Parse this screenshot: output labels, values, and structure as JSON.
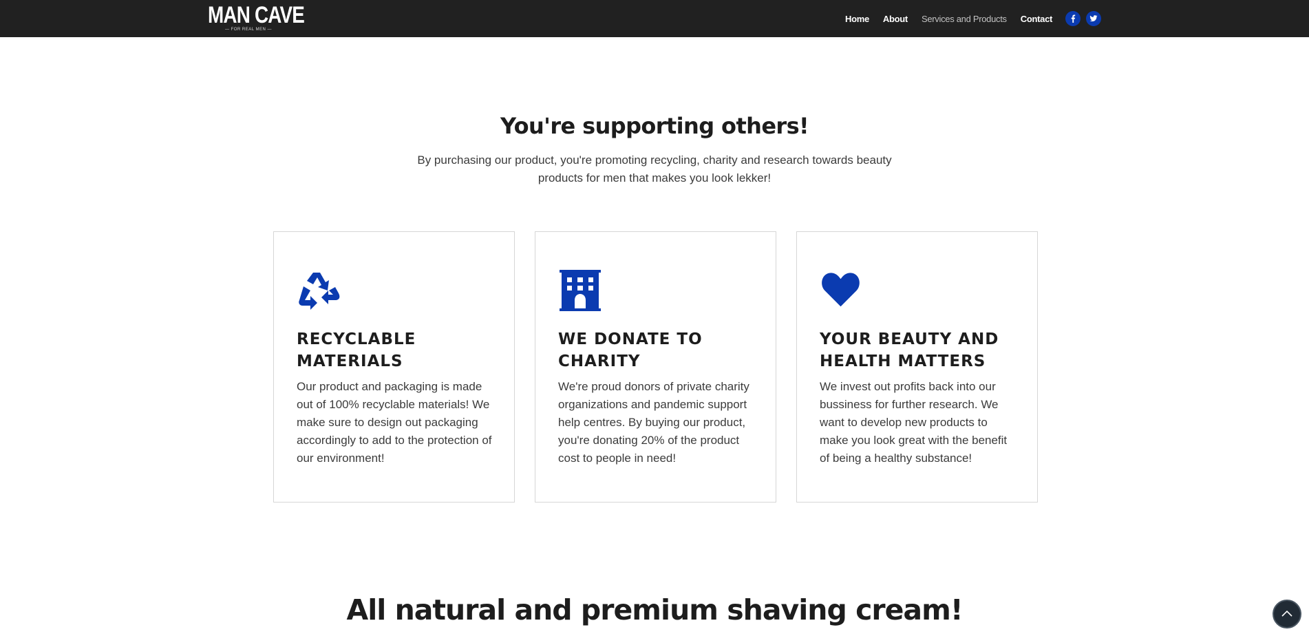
{
  "brand": {
    "name": "MAN CAVE",
    "tagline": "— FOR REAL MEN —"
  },
  "nav": {
    "items": [
      {
        "label": "Home"
      },
      {
        "label": "About"
      },
      {
        "label": "Services and Products"
      },
      {
        "label": "Contact"
      }
    ],
    "social": [
      "facebook-icon",
      "twitter-icon"
    ]
  },
  "supporting": {
    "title": "You're supporting others!",
    "subtitle": "By purchasing our product, you're promoting recycling, charity and research towards beauty products for men that makes you look lekker!"
  },
  "cards": [
    {
      "icon": "recycle-icon",
      "title": "RECYCLABLE MATERIALS",
      "text": "Our product and packaging is made out of 100% recyclable materials! We make sure to design out packaging accordingly to add to the protection of our environment!"
    },
    {
      "icon": "building-icon",
      "title": "WE DONATE TO CHARITY",
      "text": "We're proud donors of private charity organizations and pandemic support help centres. By buying our product, you're donating 20% of the product cost to people in need!"
    },
    {
      "icon": "heart-icon",
      "title": "YOUR BEAUTY AND HEALTH MATTERS",
      "text": "We invest out profits back into our bussiness for further research. We want to develop new products to make you look great with the benefit of being a healthy substance!"
    }
  ],
  "products": {
    "title": "All natural and premium shaving cream!"
  },
  "colors": {
    "accent": "#0b3bb0",
    "nav_bg": "#212121",
    "text": "#1d1d1d"
  }
}
